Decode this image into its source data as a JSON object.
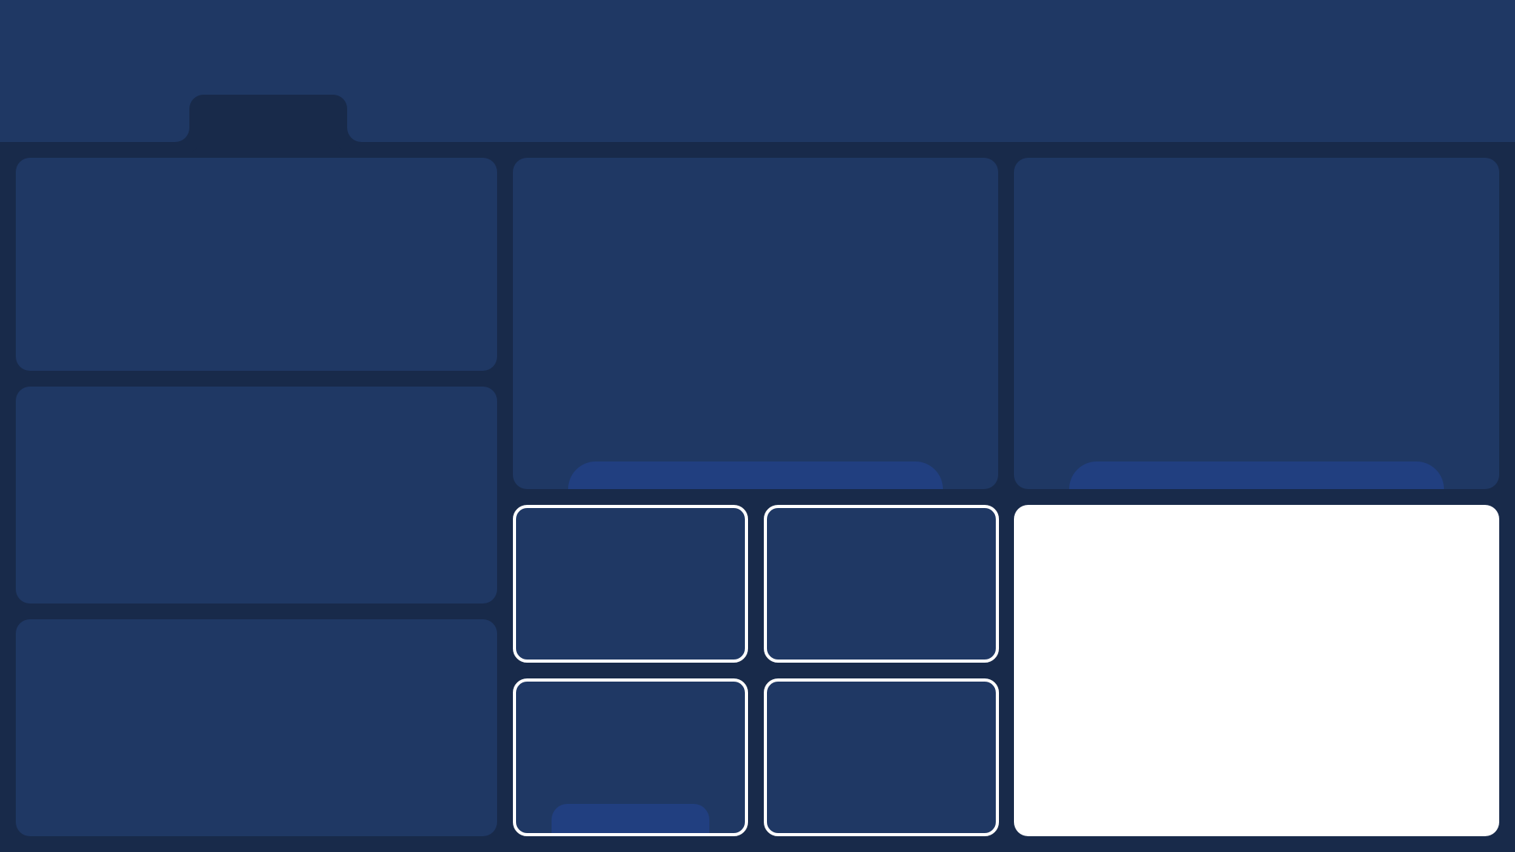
{
  "app": {
    "header": {
      "tabs": [
        {
          "state": "active"
        }
      ]
    },
    "panels": {
      "left": [
        "left-panel-1",
        "left-panel-2",
        "left-panel-3"
      ],
      "top": [
        "top-middle-panel",
        "top-right-panel"
      ],
      "cards": [
        "card-1",
        "card-2",
        "card-3",
        "card-4"
      ],
      "white": "white-panel"
    }
  },
  "colors": {
    "background": "#182a4a",
    "panel": "#1f3864",
    "accent": "#213f80",
    "card_border": "#ffffff",
    "white_panel": "#ffffff"
  }
}
